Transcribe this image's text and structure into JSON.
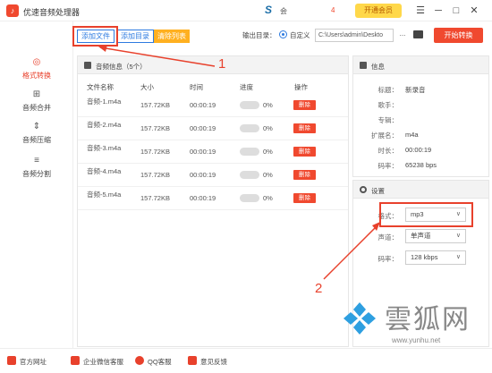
{
  "app": {
    "title": "优速音频处理器",
    "logo_char": "♪"
  },
  "titlebar": {
    "brand": "S",
    "user_label": "会",
    "badge": "4",
    "vip_label": "开通会员",
    "window_buttons": [
      "☰",
      "─",
      "□",
      "✕"
    ]
  },
  "sidebar": {
    "items": [
      {
        "label": "格式转换",
        "icon": "convert-icon",
        "glyph": "◎",
        "active": true
      },
      {
        "label": "音频合并",
        "icon": "merge-icon",
        "glyph": "⊞",
        "active": false
      },
      {
        "label": "音频压缩",
        "icon": "compress-icon",
        "glyph": "⇕",
        "active": false
      },
      {
        "label": "音频分割",
        "icon": "split-icon",
        "glyph": "≡",
        "active": false
      }
    ]
  },
  "toolbar": {
    "add_file": "添加文件",
    "add_folder": "添加目录",
    "clear_list": "清除列表",
    "output_label": "输出目录：",
    "custom_option": "自定义",
    "output_path": "C:\\Users\\admin\\Deskto",
    "more_button": "...",
    "start_button": "开始转换"
  },
  "list_panel": {
    "title": "音频信息（5个）",
    "columns": [
      "文件名称",
      "大小",
      "时间",
      "进度",
      "操作"
    ],
    "rows": [
      {
        "name": "音频-1.m4a",
        "size": "157.72KB",
        "time": "00:00:19",
        "progress": 0,
        "progress_text": "0%",
        "action": "删除"
      },
      {
        "name": "音频-2.m4a",
        "size": "157.72KB",
        "time": "00:00:19",
        "progress": 0,
        "progress_text": "0%",
        "action": "删除"
      },
      {
        "name": "音频-3.m4a",
        "size": "157.72KB",
        "time": "00:00:19",
        "progress": 0,
        "progress_text": "0%",
        "action": "删除"
      },
      {
        "name": "音频-4.m4a",
        "size": "157.72KB",
        "time": "00:00:19",
        "progress": 0,
        "progress_text": "0%",
        "action": "删除"
      },
      {
        "name": "音频-5.m4a",
        "size": "157.72KB",
        "time": "00:00:19",
        "progress": 0,
        "progress_text": "0%",
        "action": "删除"
      }
    ]
  },
  "info_panel": {
    "title": "信息",
    "fields": [
      {
        "label": "标题：",
        "value": "新录音"
      },
      {
        "label": "歌手：",
        "value": ""
      },
      {
        "label": "专辑：",
        "value": ""
      },
      {
        "label": "扩展名：",
        "value": "m4a"
      },
      {
        "label": "时长：",
        "value": "00:00:19"
      },
      {
        "label": "码率：",
        "value": "65238 bps"
      }
    ]
  },
  "settings_panel": {
    "title": "设置",
    "format_label": "格式：",
    "format_value": "mp3",
    "channel_label": "声道：",
    "channel_value": "单声道",
    "bitrate_label": "码率：",
    "bitrate_value": "128 kbps"
  },
  "footer": {
    "items": [
      "官方网址",
      "企业微信客服",
      "QQ客服",
      "意见反馈"
    ]
  },
  "annotations": {
    "step1": "1",
    "step2": "2"
  },
  "watermark": {
    "text": "雲狐网",
    "url": "www.yunhu.net"
  },
  "colors": {
    "accent_red": "#f0492f",
    "accent_blue": "#2e7be0",
    "accent_orange": "#ffb020",
    "vip_yellow": "#ffd84a"
  }
}
